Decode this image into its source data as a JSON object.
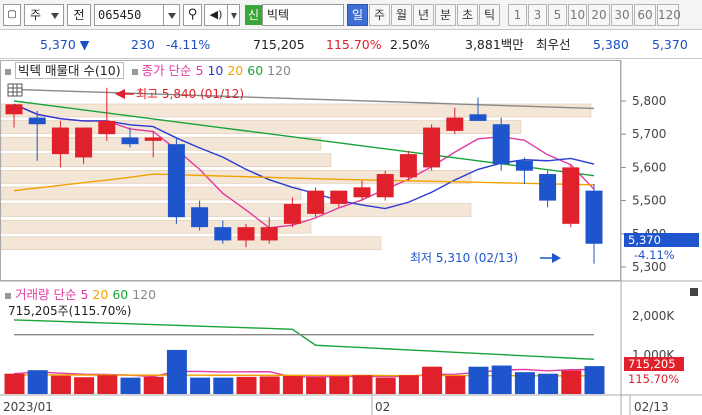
{
  "toolbar": {
    "market_label": "주",
    "jeon_label": "전",
    "code_value": "065450",
    "stock_name": "빅텍",
    "credit_badge": "신",
    "period_buttons": [
      "일",
      "주",
      "월",
      "년",
      "분",
      "초",
      "틱"
    ],
    "active_period": "일",
    "interval_buttons": [
      "1",
      "3",
      "5",
      "10",
      "20",
      "30",
      "60",
      "120"
    ]
  },
  "quote": {
    "price": "5,370",
    "change": "230",
    "change_pct": "-4.11%",
    "volume": "715,205",
    "volume_ratio": "115.70%",
    "turnover": "2.50%",
    "amount": "3,881백만",
    "best_ask_label": "최우선",
    "best_ask": "5,380",
    "best_bid": "5,370"
  },
  "price_panel": {
    "legend_name": "빅텍 매물대 수(10)",
    "legend_close": "종가 단순",
    "ma_values": [
      "5",
      "10",
      "20",
      "60",
      "120"
    ],
    "high_note": "최고 5,840 (01/12)",
    "low_note": "최저 5,310 (02/13)",
    "price_ticks": [
      "5,800",
      "5,700",
      "5,600",
      "5,500",
      "5,400",
      "5,300"
    ],
    "current_price_tag": "5,370",
    "current_change_tag": "-4.11%"
  },
  "volume_panel": {
    "legend_name": "거래량",
    "legend_ma": "단순",
    "ma_values": [
      "5",
      "20",
      "60",
      "120"
    ],
    "volume_label": "715,205주(115.70%)",
    "volume_ticks": [
      "2,000K",
      "1,000K"
    ],
    "current_volume_tag": "715,205",
    "current_ratio_tag": "115.70%"
  },
  "x_axis": {
    "labels": [
      "2023/01",
      "02",
      "02/13"
    ]
  },
  "colors": {
    "up": "#e0202a",
    "down": "#1f55cc",
    "ma5": "#e23aa2",
    "ma10": "#2a3bd1",
    "ma20": "#f2a200",
    "ma60": "#1aa33a",
    "ma120": "#888888",
    "profile": "#f4e6d6"
  },
  "chart_data": {
    "type": "candlestick",
    "x_range": [
      "2023/01",
      "02/13"
    ],
    "price_range": [
      5300,
      5840
    ],
    "candles": [
      {
        "o": 5760,
        "h": 5790,
        "l": 5720,
        "c": 5790
      },
      {
        "o": 5750,
        "h": 5770,
        "l": 5620,
        "c": 5730
      },
      {
        "o": 5640,
        "h": 5740,
        "l": 5600,
        "c": 5720
      },
      {
        "o": 5630,
        "h": 5700,
        "l": 5610,
        "c": 5720
      },
      {
        "o": 5700,
        "h": 5840,
        "l": 5680,
        "c": 5740
      },
      {
        "o": 5690,
        "h": 5720,
        "l": 5660,
        "c": 5670
      },
      {
        "o": 5680,
        "h": 5710,
        "l": 5630,
        "c": 5690
      },
      {
        "o": 5670,
        "h": 5690,
        "l": 5430,
        "c": 5450
      },
      {
        "o": 5480,
        "h": 5500,
        "l": 5410,
        "c": 5420
      },
      {
        "o": 5420,
        "h": 5440,
        "l": 5370,
        "c": 5380
      },
      {
        "o": 5380,
        "h": 5430,
        "l": 5360,
        "c": 5420
      },
      {
        "o": 5380,
        "h": 5450,
        "l": 5370,
        "c": 5420
      },
      {
        "o": 5430,
        "h": 5510,
        "l": 5420,
        "c": 5490
      },
      {
        "o": 5460,
        "h": 5540,
        "l": 5450,
        "c": 5530
      },
      {
        "o": 5490,
        "h": 5520,
        "l": 5480,
        "c": 5530
      },
      {
        "o": 5510,
        "h": 5560,
        "l": 5500,
        "c": 5540
      },
      {
        "o": 5510,
        "h": 5590,
        "l": 5500,
        "c": 5580
      },
      {
        "o": 5570,
        "h": 5650,
        "l": 5560,
        "c": 5640
      },
      {
        "o": 5600,
        "h": 5730,
        "l": 5590,
        "c": 5720
      },
      {
        "o": 5710,
        "h": 5780,
        "l": 5700,
        "c": 5750
      },
      {
        "o": 5760,
        "h": 5810,
        "l": 5740,
        "c": 5740
      },
      {
        "o": 5730,
        "h": 5750,
        "l": 5590,
        "c": 5610
      },
      {
        "o": 5620,
        "h": 5630,
        "l": 5550,
        "c": 5590
      },
      {
        "o": 5580,
        "h": 5590,
        "l": 5480,
        "c": 5500
      },
      {
        "o": 5430,
        "h": 5610,
        "l": 5420,
        "c": 5600
      },
      {
        "o": 5530,
        "h": 5550,
        "l": 5310,
        "c": 5370
      }
    ],
    "volume": [
      520,
      610,
      470,
      430,
      480,
      420,
      440,
      1130,
      420,
      420,
      440,
      450,
      460,
      430,
      450,
      480,
      420,
      480,
      700,
      460,
      700,
      730,
      560,
      520,
      600,
      715
    ],
    "volume_range": [
      0,
      2400
    ]
  }
}
